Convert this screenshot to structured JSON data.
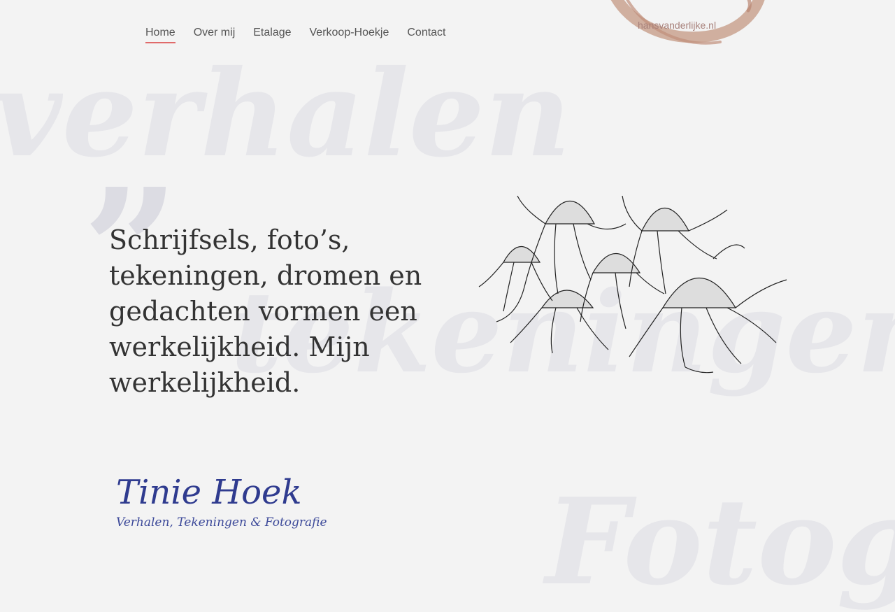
{
  "nav": {
    "items": [
      {
        "label": "Home",
        "active": true
      },
      {
        "label": "Over mij",
        "active": false
      },
      {
        "label": "Etalage",
        "active": false
      },
      {
        "label": "Verkoop-Hoekje",
        "active": false
      },
      {
        "label": "Contact",
        "active": false
      }
    ]
  },
  "logo": {
    "text": "hansvanderlijke.nl"
  },
  "background_words": [
    "verhalen",
    "tekeningen",
    "Fotog"
  ],
  "hero": {
    "quote_glyph": "”",
    "headline": "Schrijfsels, foto’s, tekeningen, dromen en gedachten vormen een werkelijkheid. Mijn werkelijkheid."
  },
  "brand": {
    "name": "Tinie Hoek",
    "subtitle": "Verhalen, Tekeningen & Fotografie"
  },
  "colors": {
    "background": "#f3f3f3",
    "nav_underline": "#e06a6a",
    "brand_blue": "#2f3b8f",
    "logo_brown": "#c9a28f"
  },
  "illustration": {
    "name": "flowers-drawing-icon"
  }
}
